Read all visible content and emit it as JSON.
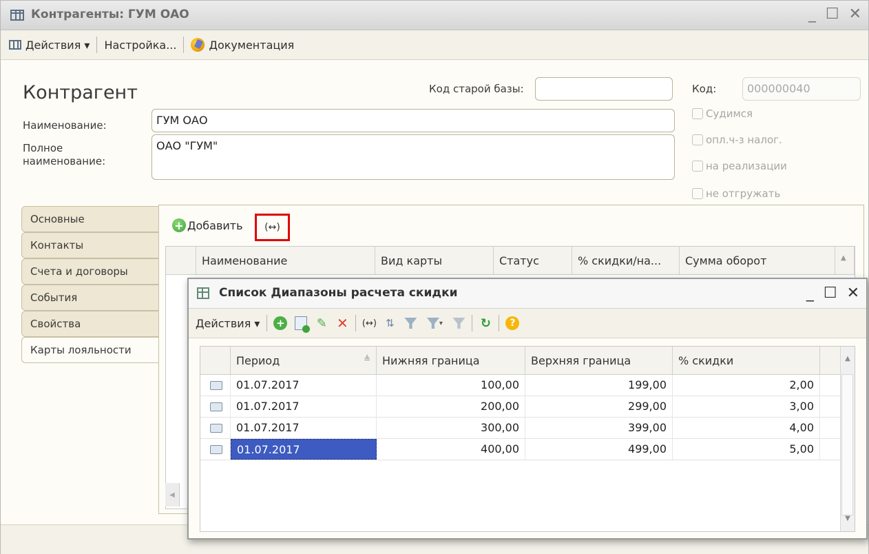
{
  "main_window": {
    "title": "Контрагенты: ГУМ ОАО",
    "controls": [
      "_",
      "☐",
      "✕"
    ]
  },
  "toolbar": {
    "actions_label": "Действия ▾",
    "settings_label": "Настройка...",
    "docs_label": "Документация"
  },
  "form": {
    "heading": "Контрагент",
    "old_code_label": "Код старой базы:",
    "old_code_value": "",
    "code_label": "Код:",
    "code_value": "000000040",
    "name_label": "Наименование:",
    "name_value": "ГУМ ОАО",
    "full_name_label_1": "Полное",
    "full_name_label_2": "наименование:",
    "full_name_value": "ОАО \"ГУМ\"",
    "checkboxes": [
      "Судимся",
      "опл.ч-з налог.",
      "на реализации",
      "не отгружать"
    ]
  },
  "tabs": [
    "Основные",
    "Контакты",
    "Счета и договоры",
    "События",
    "Свойства",
    "Карты лояльности"
  ],
  "cards_tab": {
    "add_label": "Добавить",
    "highlight_button_label": "(↔)",
    "columns": [
      "Наименование",
      "Вид карты",
      "Статус",
      "% скидки/на...",
      "Сумма оборот"
    ]
  },
  "child_window": {
    "title": "Список Диапазоны расчета скидки",
    "controls": [
      "_",
      "☐",
      "✕"
    ],
    "actions_label": "Действия ▾",
    "columns": [
      "Период",
      "Нижняя граница",
      "Верхняя граница",
      "% скидки"
    ],
    "rows": [
      {
        "period": "01.07.2017",
        "lower": "100,00",
        "upper": "199,00",
        "discount": "2,00"
      },
      {
        "period": "01.07.2017",
        "lower": "200,00",
        "upper": "299,00",
        "discount": "3,00"
      },
      {
        "period": "01.07.2017",
        "lower": "300,00",
        "upper": "399,00",
        "discount": "4,00"
      },
      {
        "period": "01.07.2017",
        "lower": "400,00",
        "upper": "499,00",
        "discount": "5,00"
      }
    ],
    "selected_row": 3
  },
  "colors": {
    "highlight_border": "#e00000",
    "selection": "#3d5bc0"
  }
}
